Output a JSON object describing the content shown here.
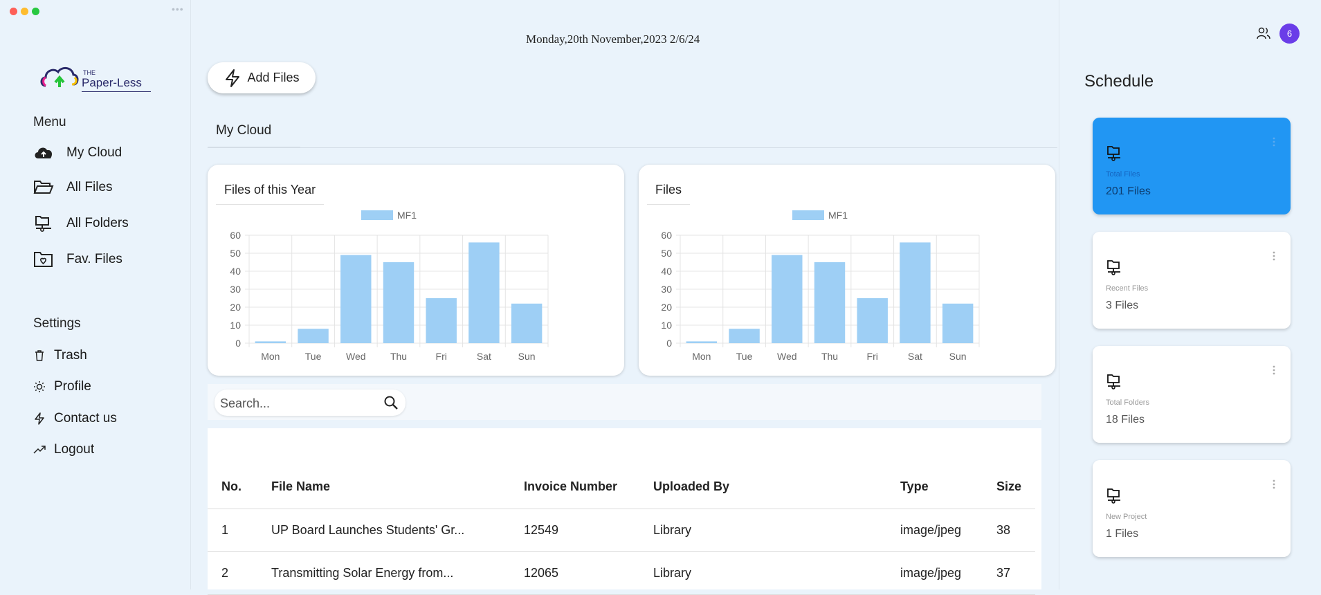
{
  "sidebar": {
    "logo": {
      "the": "THE",
      "name": "Paper-Less"
    },
    "menu_heading": "Menu",
    "menu_items": [
      {
        "label": "My Cloud",
        "icon": "cloud-upload-icon"
      },
      {
        "label": "All Files",
        "icon": "folder-open-icon"
      },
      {
        "label": "All Folders",
        "icon": "network-folder-icon"
      },
      {
        "label": "Fav. Files",
        "icon": "heart-folder-icon"
      }
    ],
    "settings_heading": "Settings",
    "settings_items": [
      {
        "label": "Trash",
        "icon": "trash-icon"
      },
      {
        "label": "Profile",
        "icon": "sun-icon"
      },
      {
        "label": "Contact us",
        "icon": "bolt-icon"
      },
      {
        "label": "Logout",
        "icon": "trending-up-icon"
      }
    ]
  },
  "header": {
    "datetime": "Monday,20th November,2023 2/6/24"
  },
  "toolbar": {
    "add_files_label": "Add Files"
  },
  "tabs": {
    "my_cloud": "My Cloud"
  },
  "charts": {
    "year": {
      "title": "Files of this Year"
    },
    "files": {
      "title": "Files"
    }
  },
  "chart_data": [
    {
      "type": "bar",
      "title": "Files of this Year",
      "categories": [
        "Mon",
        "Tue",
        "Wed",
        "Thu",
        "Fri",
        "Sat",
        "Sun"
      ],
      "series": [
        {
          "name": "MF1",
          "values": [
            1,
            8,
            49,
            45,
            25,
            56,
            22
          ]
        }
      ],
      "ylim": [
        0,
        60
      ],
      "yticks": [
        0,
        10,
        20,
        30,
        40,
        50,
        60
      ],
      "grid": true,
      "legend": "top-center",
      "color": "#9ecff5"
    },
    {
      "type": "bar",
      "title": "Files",
      "categories": [
        "Mon",
        "Tue",
        "Wed",
        "Thu",
        "Fri",
        "Sat",
        "Sun"
      ],
      "series": [
        {
          "name": "MF1",
          "values": [
            1,
            8,
            49,
            45,
            25,
            56,
            22
          ]
        }
      ],
      "ylim": [
        0,
        60
      ],
      "yticks": [
        0,
        10,
        20,
        30,
        40,
        50,
        60
      ],
      "grid": true,
      "legend": "top-center",
      "color": "#9ecff5"
    }
  ],
  "search": {
    "placeholder": "Search..."
  },
  "table": {
    "headers": [
      "No.",
      "File Name",
      "Invoice Number",
      "Uploaded By",
      "Type",
      "Size"
    ],
    "rows": [
      [
        "1",
        "UP Board Launches Students' Gr...",
        "12549",
        "Library",
        "image/jpeg",
        "38"
      ],
      [
        "2",
        "Transmitting Solar Energy from...",
        "12065",
        "Library",
        "image/jpeg",
        "37"
      ]
    ]
  },
  "schedule": {
    "title": "Schedule",
    "badge_count": "6",
    "cards": [
      {
        "label": "Total Files",
        "count": "201 Files",
        "active": true
      },
      {
        "label": "Recent Files",
        "count": "3 Files",
        "active": false
      },
      {
        "label": "Total Folders",
        "count": "18 Files",
        "active": false
      },
      {
        "label": "New Project",
        "count": "1 Files",
        "active": false
      }
    ]
  },
  "colors": {
    "accent": "#2196f3",
    "bar": "#9ecff5",
    "avatar": "#6a3de8",
    "background": "#eaf3fb"
  }
}
